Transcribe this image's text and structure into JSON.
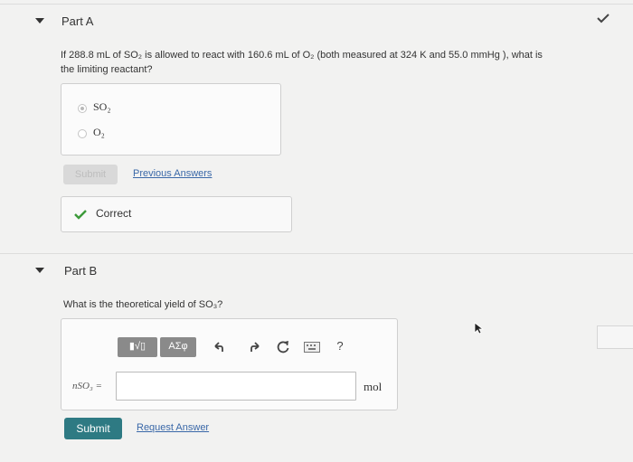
{
  "partA": {
    "title": "Part A",
    "question_pre": "If 288.8 mL of SO₂ is allowed to react with 160.6 mL of O₂ (both measured at 324 K and 55.0 mmHg ), what is",
    "question_post": "the limiting reactant?",
    "options": [
      "SO₂",
      "O₂"
    ],
    "selected": "SO₂",
    "submit_label": "Submit",
    "previous_answers_label": "Previous Answers",
    "feedback": "Correct"
  },
  "partB": {
    "title": "Part B",
    "question": "What is the theoretical yield of SO₃?",
    "toolbar": {
      "template_label": "▮√▯",
      "greek_label": "ΑΣφ",
      "undo": "undo-icon",
      "redo": "redo-icon",
      "reset": "reset-icon",
      "keyboard": "keyboard-icon",
      "help_label": "?"
    },
    "variable_label": "nSO₃ =",
    "input_value": "",
    "unit": "mol",
    "submit_label": "Submit",
    "request_answer_label": "Request Answer"
  },
  "colors": {
    "submit": "#2e7a83",
    "link": "#3a68a8",
    "correct": "#3c9a3a"
  }
}
